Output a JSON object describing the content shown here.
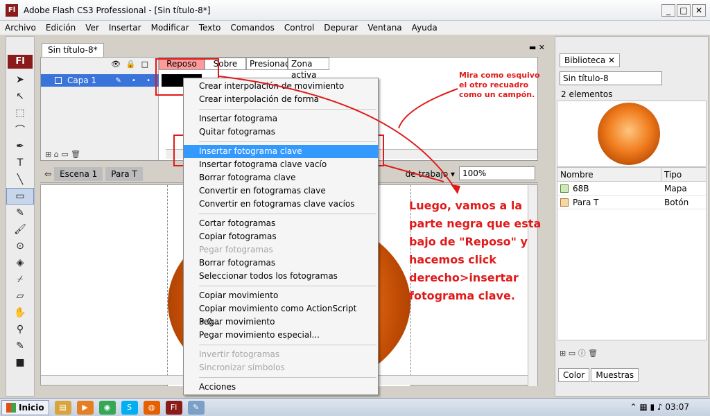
{
  "window": {
    "title": "Adobe Flash CS3 Professional - [Sin título-8*]",
    "app_icon_text": "Fl"
  },
  "menubar": {
    "items": [
      "Archivo",
      "Edición",
      "Ver",
      "Insertar",
      "Modificar",
      "Texto",
      "Comandos",
      "Control",
      "Depurar",
      "Ventana",
      "Ayuda"
    ]
  },
  "toolbar": {
    "logo": "Fl"
  },
  "document": {
    "tab": "Sin título-8*",
    "timeline": {
      "frame_labels": [
        "Reposo",
        "Sobre",
        "Presionado",
        "Zona activa"
      ],
      "layer_name": "Capa 1"
    },
    "scene": {
      "items": [
        "Escena 1",
        "Para T"
      ],
      "workspace": "de trabajo ▾",
      "zoom": "100%"
    }
  },
  "context_menu": {
    "items": [
      {
        "label": "Crear interpolación de movimiento",
        "state": "normal"
      },
      {
        "label": "Crear interpolación de forma",
        "state": "normal"
      },
      {
        "sep": true
      },
      {
        "label": "Insertar fotograma",
        "state": "normal"
      },
      {
        "label": "Quitar fotogramas",
        "state": "normal"
      },
      {
        "sep": true
      },
      {
        "label": "Insertar fotograma clave",
        "state": "highlight"
      },
      {
        "label": "Insertar fotograma clave vacío",
        "state": "normal"
      },
      {
        "label": "Borrar fotograma clave",
        "state": "normal"
      },
      {
        "label": "Convertir en fotogramas clave",
        "state": "normal"
      },
      {
        "label": "Convertir en fotogramas clave vacíos",
        "state": "normal"
      },
      {
        "sep": true
      },
      {
        "label": "Cortar fotogramas",
        "state": "normal"
      },
      {
        "label": "Copiar fotogramas",
        "state": "normal"
      },
      {
        "label": "Pegar fotogramas",
        "state": "disabled"
      },
      {
        "label": "Borrar fotogramas",
        "state": "normal"
      },
      {
        "label": "Seleccionar todos los fotogramas",
        "state": "normal"
      },
      {
        "sep": true
      },
      {
        "label": "Copiar movimiento",
        "state": "normal"
      },
      {
        "label": "Copiar movimiento como ActionScript 3.0...",
        "state": "normal"
      },
      {
        "label": "Pegar movimiento",
        "state": "normal"
      },
      {
        "label": "Pegar movimiento especial...",
        "state": "normal"
      },
      {
        "sep": true
      },
      {
        "label": "Invertir fotogramas",
        "state": "disabled"
      },
      {
        "label": "Sincronizar símbolos",
        "state": "disabled"
      },
      {
        "sep": true
      },
      {
        "label": "Acciones",
        "state": "normal"
      }
    ]
  },
  "annotations": {
    "small_note": "Mira como esquivo el otro recuadro como un campón.",
    "big_note": "Luego, vamos a la parte negra que esta bajo de \"Reposo\" y hacemos click derecho>insertar fotograma clave.",
    "color": "#e01a1a"
  },
  "library": {
    "tab": "Biblioteca",
    "document": "Sin título-8",
    "count": "2 elementos",
    "columns": [
      "Nombre",
      "Tipo"
    ],
    "rows": [
      {
        "name": "68B",
        "type": "Mapa"
      },
      {
        "name": "Para T",
        "type": "Botón"
      }
    ],
    "bottom_tabs": [
      "Color",
      "Muestras"
    ]
  },
  "taskbar": {
    "start": "Inicio",
    "clock": "03:07"
  }
}
